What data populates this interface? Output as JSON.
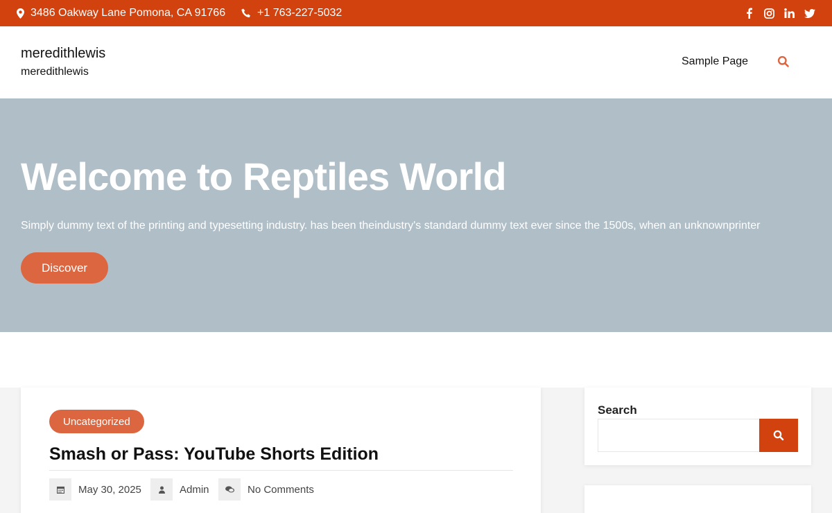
{
  "topbar": {
    "address": "3486 Oakway Lane Pomona, CA 91766",
    "phone": "+1 763-227-5032",
    "socials": [
      "facebook-icon",
      "instagram-icon",
      "linkedin-icon",
      "twitter-icon"
    ]
  },
  "header": {
    "site_title": "meredithlewis",
    "tagline": "meredithlewis",
    "nav": [
      {
        "label": "Sample Page"
      }
    ]
  },
  "hero": {
    "title": "Welcome to Reptiles World",
    "text": "Simply dummy text of the printing and typesetting industry. has been theindustry's standard dummy text ever since the 1500s, when an unknownprinter",
    "button": "Discover"
  },
  "post": {
    "category": "Uncategorized",
    "title": "Smash or Pass: YouTube Shorts Edition",
    "date": "May 30, 2025",
    "author": "Admin",
    "comments": "No Comments"
  },
  "sidebar": {
    "search_title": "Search",
    "search_placeholder": ""
  },
  "colors": {
    "accent": "#d2420f",
    "button": "#dc6640",
    "hero_bg": "#afbec7"
  }
}
